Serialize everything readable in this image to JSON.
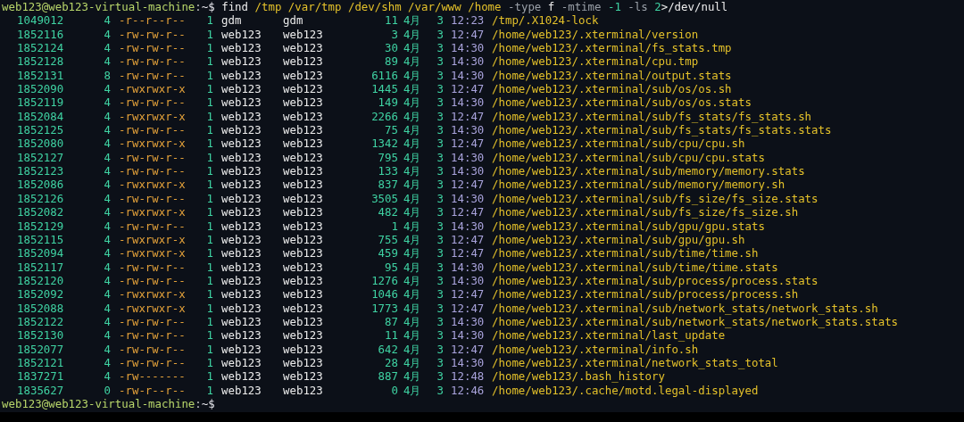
{
  "terminal": {
    "command_line": {
      "prompt": {
        "user_host": "web123@web123-virtual-machine",
        "separator": ":",
        "cwd": "~$"
      },
      "tokens": [
        {
          "text": "find",
          "kind": "command"
        },
        {
          "text": "/tmp /var/tmp /dev/shm /var/www /home",
          "kind": "path"
        },
        {
          "text": "-type",
          "kind": "option"
        },
        {
          "text": "f",
          "kind": "arg"
        },
        {
          "text": "-mtime",
          "kind": "option"
        },
        {
          "text": "-1",
          "kind": "number"
        },
        {
          "text": "-ls",
          "kind": "option"
        },
        {
          "text": "2",
          "kind": "number"
        },
        {
          "text": ">/dev/null",
          "kind": "redirect"
        }
      ]
    },
    "rows": [
      {
        "inode": "1049012",
        "blocks": "4",
        "perms": "-r--r--r--",
        "links": "1",
        "owner": "gdm",
        "group": "gdm",
        "size": "11",
        "month": "4月",
        "day": "3",
        "time": "12:23",
        "path": "/tmp/.X1024-lock"
      },
      {
        "inode": "1852116",
        "blocks": "4",
        "perms": "-rw-rw-r--",
        "links": "1",
        "owner": "web123",
        "group": "web123",
        "size": "3",
        "month": "4月",
        "day": "3",
        "time": "12:47",
        "path": "/home/web123/.xterminal/version"
      },
      {
        "inode": "1852124",
        "blocks": "4",
        "perms": "-rw-rw-r--",
        "links": "1",
        "owner": "web123",
        "group": "web123",
        "size": "30",
        "month": "4月",
        "day": "3",
        "time": "14:30",
        "path": "/home/web123/.xterminal/fs_stats.tmp"
      },
      {
        "inode": "1852128",
        "blocks": "4",
        "perms": "-rw-rw-r--",
        "links": "1",
        "owner": "web123",
        "group": "web123",
        "size": "89",
        "month": "4月",
        "day": "3",
        "time": "14:30",
        "path": "/home/web123/.xterminal/cpu.tmp"
      },
      {
        "inode": "1852131",
        "blocks": "8",
        "perms": "-rw-rw-r--",
        "links": "1",
        "owner": "web123",
        "group": "web123",
        "size": "6116",
        "month": "4月",
        "day": "3",
        "time": "14:30",
        "path": "/home/web123/.xterminal/output.stats"
      },
      {
        "inode": "1852090",
        "blocks": "4",
        "perms": "-rwxrwxr-x",
        "links": "1",
        "owner": "web123",
        "group": "web123",
        "size": "1445",
        "month": "4月",
        "day": "3",
        "time": "12:47",
        "path": "/home/web123/.xterminal/sub/os/os.sh"
      },
      {
        "inode": "1852119",
        "blocks": "4",
        "perms": "-rw-rw-r--",
        "links": "1",
        "owner": "web123",
        "group": "web123",
        "size": "149",
        "month": "4月",
        "day": "3",
        "time": "14:30",
        "path": "/home/web123/.xterminal/sub/os/os.stats"
      },
      {
        "inode": "1852084",
        "blocks": "4",
        "perms": "-rwxrwxr-x",
        "links": "1",
        "owner": "web123",
        "group": "web123",
        "size": "2266",
        "month": "4月",
        "day": "3",
        "time": "12:47",
        "path": "/home/web123/.xterminal/sub/fs_stats/fs_stats.sh"
      },
      {
        "inode": "1852125",
        "blocks": "4",
        "perms": "-rw-rw-r--",
        "links": "1",
        "owner": "web123",
        "group": "web123",
        "size": "75",
        "month": "4月",
        "day": "3",
        "time": "14:30",
        "path": "/home/web123/.xterminal/sub/fs_stats/fs_stats.stats"
      },
      {
        "inode": "1852080",
        "blocks": "4",
        "perms": "-rwxrwxr-x",
        "links": "1",
        "owner": "web123",
        "group": "web123",
        "size": "1342",
        "month": "4月",
        "day": "3",
        "time": "12:47",
        "path": "/home/web123/.xterminal/sub/cpu/cpu.sh"
      },
      {
        "inode": "1852127",
        "blocks": "4",
        "perms": "-rw-rw-r--",
        "links": "1",
        "owner": "web123",
        "group": "web123",
        "size": "795",
        "month": "4月",
        "day": "3",
        "time": "14:30",
        "path": "/home/web123/.xterminal/sub/cpu/cpu.stats"
      },
      {
        "inode": "1852123",
        "blocks": "4",
        "perms": "-rw-rw-r--",
        "links": "1",
        "owner": "web123",
        "group": "web123",
        "size": "133",
        "month": "4月",
        "day": "3",
        "time": "14:30",
        "path": "/home/web123/.xterminal/sub/memory/memory.stats"
      },
      {
        "inode": "1852086",
        "blocks": "4",
        "perms": "-rwxrwxr-x",
        "links": "1",
        "owner": "web123",
        "group": "web123",
        "size": "837",
        "month": "4月",
        "day": "3",
        "time": "12:47",
        "path": "/home/web123/.xterminal/sub/memory/memory.sh"
      },
      {
        "inode": "1852126",
        "blocks": "4",
        "perms": "-rw-rw-r--",
        "links": "1",
        "owner": "web123",
        "group": "web123",
        "size": "3505",
        "month": "4月",
        "day": "3",
        "time": "14:30",
        "path": "/home/web123/.xterminal/sub/fs_size/fs_size.stats"
      },
      {
        "inode": "1852082",
        "blocks": "4",
        "perms": "-rwxrwxr-x",
        "links": "1",
        "owner": "web123",
        "group": "web123",
        "size": "482",
        "month": "4月",
        "day": "3",
        "time": "12:47",
        "path": "/home/web123/.xterminal/sub/fs_size/fs_size.sh"
      },
      {
        "inode": "1852129",
        "blocks": "4",
        "perms": "-rw-rw-r--",
        "links": "1",
        "owner": "web123",
        "group": "web123",
        "size": "1",
        "month": "4月",
        "day": "3",
        "time": "14:30",
        "path": "/home/web123/.xterminal/sub/gpu/gpu.stats"
      },
      {
        "inode": "1852115",
        "blocks": "4",
        "perms": "-rwxrwxr-x",
        "links": "1",
        "owner": "web123",
        "group": "web123",
        "size": "755",
        "month": "4月",
        "day": "3",
        "time": "12:47",
        "path": "/home/web123/.xterminal/sub/gpu/gpu.sh"
      },
      {
        "inode": "1852094",
        "blocks": "4",
        "perms": "-rwxrwxr-x",
        "links": "1",
        "owner": "web123",
        "group": "web123",
        "size": "459",
        "month": "4月",
        "day": "3",
        "time": "12:47",
        "path": "/home/web123/.xterminal/sub/time/time.sh"
      },
      {
        "inode": "1852117",
        "blocks": "4",
        "perms": "-rw-rw-r--",
        "links": "1",
        "owner": "web123",
        "group": "web123",
        "size": "95",
        "month": "4月",
        "day": "3",
        "time": "14:30",
        "path": "/home/web123/.xterminal/sub/time/time.stats"
      },
      {
        "inode": "1852120",
        "blocks": "4",
        "perms": "-rw-rw-r--",
        "links": "1",
        "owner": "web123",
        "group": "web123",
        "size": "1276",
        "month": "4月",
        "day": "3",
        "time": "14:30",
        "path": "/home/web123/.xterminal/sub/process/process.stats"
      },
      {
        "inode": "1852092",
        "blocks": "4",
        "perms": "-rwxrwxr-x",
        "links": "1",
        "owner": "web123",
        "group": "web123",
        "size": "1046",
        "month": "4月",
        "day": "3",
        "time": "12:47",
        "path": "/home/web123/.xterminal/sub/process/process.sh"
      },
      {
        "inode": "1852088",
        "blocks": "4",
        "perms": "-rwxrwxr-x",
        "links": "1",
        "owner": "web123",
        "group": "web123",
        "size": "1773",
        "month": "4月",
        "day": "3",
        "time": "12:47",
        "path": "/home/web123/.xterminal/sub/network_stats/network_stats.sh"
      },
      {
        "inode": "1852122",
        "blocks": "4",
        "perms": "-rw-rw-r--",
        "links": "1",
        "owner": "web123",
        "group": "web123",
        "size": "87",
        "month": "4月",
        "day": "3",
        "time": "14:30",
        "path": "/home/web123/.xterminal/sub/network_stats/network_stats.stats"
      },
      {
        "inode": "1852130",
        "blocks": "4",
        "perms": "-rw-rw-r--",
        "links": "1",
        "owner": "web123",
        "group": "web123",
        "size": "11",
        "month": "4月",
        "day": "3",
        "time": "14:30",
        "path": "/home/web123/.xterminal/last_update"
      },
      {
        "inode": "1852077",
        "blocks": "4",
        "perms": "-rw-rw-r--",
        "links": "1",
        "owner": "web123",
        "group": "web123",
        "size": "642",
        "month": "4月",
        "day": "3",
        "time": "12:47",
        "path": "/home/web123/.xterminal/info.sh"
      },
      {
        "inode": "1852121",
        "blocks": "4",
        "perms": "-rw-rw-r--",
        "links": "1",
        "owner": "web123",
        "group": "web123",
        "size": "28",
        "month": "4月",
        "day": "3",
        "time": "14:30",
        "path": "/home/web123/.xterminal/network_stats_total"
      },
      {
        "inode": "1837271",
        "blocks": "4",
        "perms": "-rw-------",
        "links": "1",
        "owner": "web123",
        "group": "web123",
        "size": "887",
        "month": "4月",
        "day": "3",
        "time": "12:48",
        "path": "/home/web123/.bash_history"
      },
      {
        "inode": "1835627",
        "blocks": "0",
        "perms": "-rw-r--r--",
        "links": "1",
        "owner": "web123",
        "group": "web123",
        "size": "0",
        "month": "4月",
        "day": "3",
        "time": "12:46",
        "path": "/home/web123/.cache/motd.legal-displayed"
      }
    ],
    "final_prompt": {
      "user_host": "web123@web123-virtual-machine",
      "separator": ":",
      "cwd": "~$"
    }
  }
}
